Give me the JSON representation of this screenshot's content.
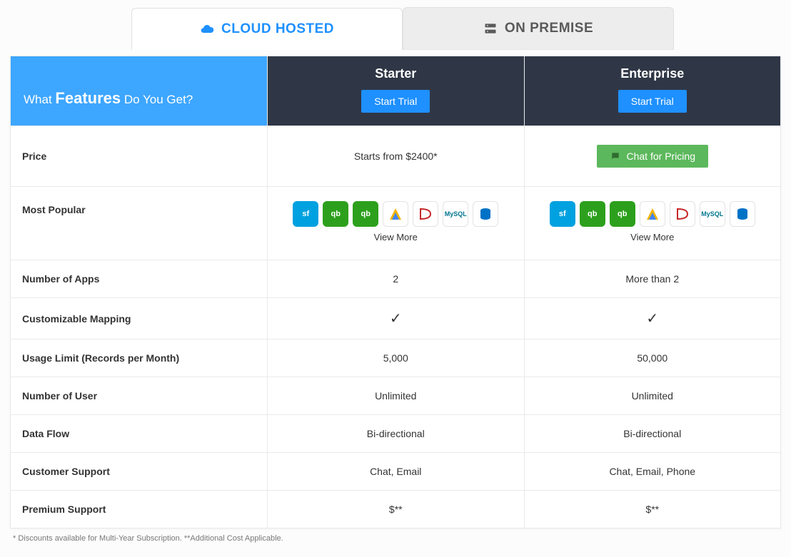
{
  "tabs": {
    "cloud": "CLOUD HOSTED",
    "onprem": "ON PREMISE"
  },
  "header": {
    "features_prefix": "What ",
    "features_bold": "Features",
    "features_suffix": " Do You Get?"
  },
  "plans": {
    "starter": {
      "name": "Starter",
      "trial_label": "Start Trial"
    },
    "enterprise": {
      "name": "Enterprise",
      "trial_label": "Start Trial"
    }
  },
  "labels": {
    "price": "Price",
    "most_popular": "Most Popular",
    "num_apps": "Number of Apps",
    "custom_mapping": "Customizable Mapping",
    "usage_limit": "Usage Limit (Records per Month)",
    "num_user": "Number of User",
    "data_flow": "Data Flow",
    "support": "Customer Support",
    "premium": "Premium Support"
  },
  "values": {
    "starter": {
      "price": "Starts from $2400*",
      "view_more": "View More",
      "num_apps": "2",
      "usage_limit": "5,000",
      "num_user": "Unlimited",
      "data_flow": "Bi-directional",
      "support": "Chat, Email",
      "premium": "$**"
    },
    "enterprise": {
      "chat_pricing": "Chat for Pricing",
      "view_more": "View More",
      "num_apps": "More than 2",
      "usage_limit": "50,000",
      "num_user": "Unlimited",
      "data_flow": "Bi-directional",
      "support": "Chat, Email, Phone",
      "premium": "$**"
    }
  },
  "app_icons": [
    "salesforce-icon",
    "quickbooks-online-icon",
    "quickbooks-desktop-icon",
    "dynamics-gp-icon",
    "dynamics-365-icon",
    "mysql-icon",
    "azure-sql-icon"
  ],
  "footnote": "* Discounts available for Multi-Year Subscription. **Additional Cost Applicable."
}
